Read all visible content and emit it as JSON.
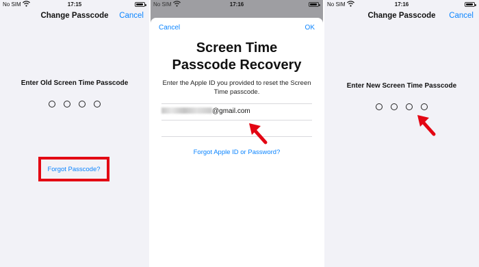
{
  "status_bar": {
    "left": {
      "carrier": "No SIM",
      "time": "17:15"
    },
    "middle": {
      "carrier": "No SIM",
      "time": "17:16"
    },
    "right": {
      "carrier": "No SIM",
      "time": "17:16"
    }
  },
  "screen_left": {
    "title": "Change Passcode",
    "cancel": "Cancel",
    "prompt": "Enter Old Screen Time Passcode",
    "forgot_link": "Forgot Passcode?",
    "passcode_digits_entered": 0,
    "passcode_length": 4
  },
  "screen_middle": {
    "cancel": "Cancel",
    "ok": "OK",
    "title_line1": "Screen Time",
    "title_line2": "Passcode Recovery",
    "subtitle": "Enter the Apple ID you provided to reset the Screen Time passcode.",
    "email_visible_suffix": "@gmail.com",
    "forgot_apple_id": "Forgot Apple ID or Password?"
  },
  "screen_right": {
    "title": "Change Passcode",
    "cancel": "Cancel",
    "prompt": "Enter New Screen Time Passcode",
    "passcode_digits_entered": 0,
    "passcode_length": 4
  },
  "colors": {
    "accent": "#0a84ff",
    "highlight": "#e30613",
    "background": "#f2f2f7"
  }
}
